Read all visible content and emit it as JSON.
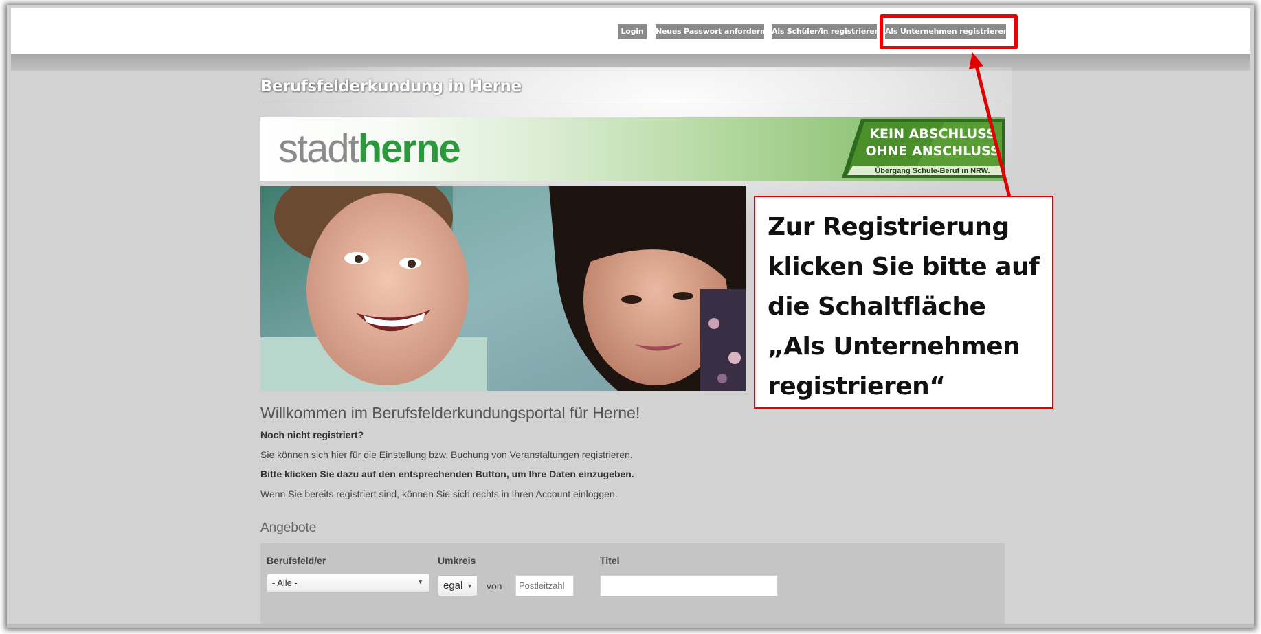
{
  "nav": {
    "login": "Login",
    "new_password": "Neues Passwort anfordern",
    "register_student": "Als Schüler/in registrieren",
    "register_company": "Als Unternehmen registrieren"
  },
  "site_title": "Berufsfelderkundung in Herne",
  "banner": {
    "logo_part1": "stadt",
    "logo_part2": "herne",
    "badge_line1": "KEIN ABSCHLUSS",
    "badge_line2": "OHNE ANSCHLUSS",
    "badge_sub": "Übergang Schule-Beruf in NRW."
  },
  "callout": {
    "lines": [
      "Zur Registrierung",
      "klicken Sie bitte auf",
      "die Schaltfläche",
      "„Als Unternehmen",
      "registrieren“"
    ],
    "color": "#e10000"
  },
  "welcome": {
    "heading": "Willkommen im Berufsfelderkundungsportal für Herne!",
    "not_registered": "Noch nicht registriert?",
    "line1": "Sie können sich hier für die Einstellung bzw. Buchung von Veranstaltungen registrieren.",
    "line2": "Bitte klicken Sie dazu auf den entsprechenden Button, um Ihre Daten einzugeben.",
    "line3": "Wenn Sie bereits registriert sind, können Sie sich rechts in Ihren Account einloggen."
  },
  "offers": {
    "heading": "Angebote",
    "field_label": "Berufsfeld/er",
    "field_value": "- Alle -",
    "radius_label": "Umkreis",
    "radius_value": "egal",
    "von": "von",
    "plz_placeholder": "Postleitzahl",
    "title_label": "Titel",
    "title_value": ""
  },
  "colors": {
    "button_bg": "#8a8a8a",
    "highlight": "#ee0000",
    "brand_green": "#2a9a3d"
  }
}
